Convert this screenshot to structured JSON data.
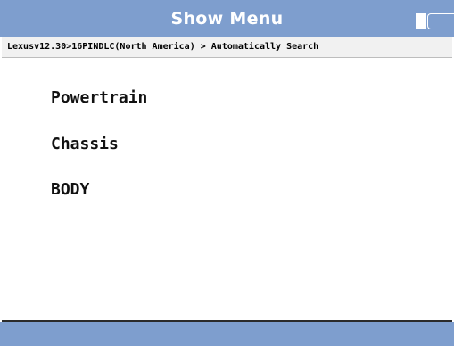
{
  "header": {
    "title": "Show Menu",
    "battery_icon": "battery-icon"
  },
  "breadcrumb": {
    "path": "Lexusv12.30>16PINDLC(North America) > Automatically Search"
  },
  "menu": {
    "items": [
      {
        "label": "Powertrain"
      },
      {
        "label": "Chassis"
      },
      {
        "label": "BODY"
      }
    ]
  },
  "colors": {
    "bar": "#7e9ece",
    "breadcrumb_bg": "#f1f1f1",
    "text": "#111111"
  }
}
